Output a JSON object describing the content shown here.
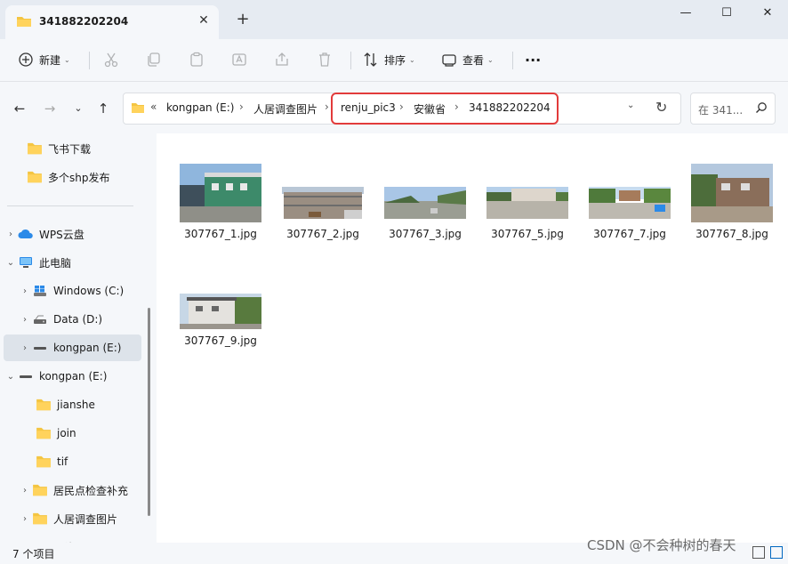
{
  "window": {
    "tab_title": "341882202204",
    "tab_close": "✕",
    "new_tab": "+",
    "minimize": "—",
    "maximize": "☐",
    "close": "✕"
  },
  "toolbar": {
    "new_label": "新建",
    "sort_label": "排序",
    "view_label": "查看",
    "more_label": "···"
  },
  "address": {
    "overflow": "«",
    "crumbs": [
      "kongpan (E:)",
      "人居调查图片",
      "renju_pic3",
      "安徽省",
      "341882202204"
    ],
    "separator": "›",
    "search_placeholder": "在 341...",
    "highlight_color": "#e23b3b"
  },
  "sidebar": {
    "quick": [
      "飞书下载",
      "多个shp发布"
    ],
    "wps": "WPS云盘",
    "this_pc": "此电脑",
    "drives": [
      "Windows (C:)",
      "Data (D:)",
      "kongpan (E:)"
    ],
    "kongpan_root": "kongpan (E:)",
    "kongpan_children": [
      "jianshe",
      "join",
      "tif",
      "居民点检查补充",
      "人居调查图片"
    ],
    "network": "网络"
  },
  "files": [
    {
      "name": "307767_1.jpg"
    },
    {
      "name": "307767_2.jpg"
    },
    {
      "name": "307767_3.jpg"
    },
    {
      "name": "307767_5.jpg"
    },
    {
      "name": "307767_7.jpg"
    },
    {
      "name": "307767_8.jpg"
    },
    {
      "name": "307767_9.jpg"
    }
  ],
  "status": {
    "count": "7 个项目"
  },
  "watermark": "CSDN @不会种树的春天",
  "colors": {
    "folder": "#f4c542",
    "accent": "#0067c0"
  }
}
